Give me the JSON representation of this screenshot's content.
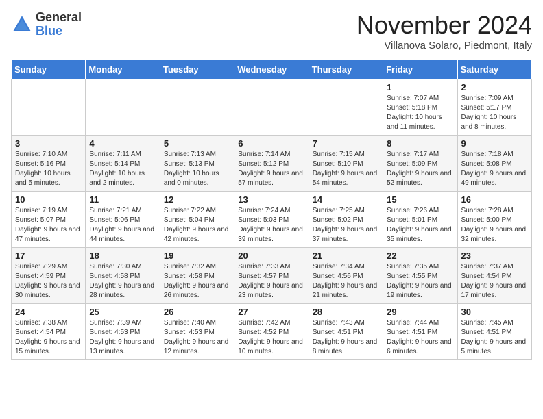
{
  "header": {
    "logo_general": "General",
    "logo_blue": "Blue",
    "month_title": "November 2024",
    "location": "Villanova Solaro, Piedmont, Italy"
  },
  "days_of_week": [
    "Sunday",
    "Monday",
    "Tuesday",
    "Wednesday",
    "Thursday",
    "Friday",
    "Saturday"
  ],
  "weeks": [
    [
      {
        "day": "",
        "info": ""
      },
      {
        "day": "",
        "info": ""
      },
      {
        "day": "",
        "info": ""
      },
      {
        "day": "",
        "info": ""
      },
      {
        "day": "",
        "info": ""
      },
      {
        "day": "1",
        "info": "Sunrise: 7:07 AM\nSunset: 5:18 PM\nDaylight: 10 hours and 11 minutes."
      },
      {
        "day": "2",
        "info": "Sunrise: 7:09 AM\nSunset: 5:17 PM\nDaylight: 10 hours and 8 minutes."
      }
    ],
    [
      {
        "day": "3",
        "info": "Sunrise: 7:10 AM\nSunset: 5:16 PM\nDaylight: 10 hours and 5 minutes."
      },
      {
        "day": "4",
        "info": "Sunrise: 7:11 AM\nSunset: 5:14 PM\nDaylight: 10 hours and 2 minutes."
      },
      {
        "day": "5",
        "info": "Sunrise: 7:13 AM\nSunset: 5:13 PM\nDaylight: 10 hours and 0 minutes."
      },
      {
        "day": "6",
        "info": "Sunrise: 7:14 AM\nSunset: 5:12 PM\nDaylight: 9 hours and 57 minutes."
      },
      {
        "day": "7",
        "info": "Sunrise: 7:15 AM\nSunset: 5:10 PM\nDaylight: 9 hours and 54 minutes."
      },
      {
        "day": "8",
        "info": "Sunrise: 7:17 AM\nSunset: 5:09 PM\nDaylight: 9 hours and 52 minutes."
      },
      {
        "day": "9",
        "info": "Sunrise: 7:18 AM\nSunset: 5:08 PM\nDaylight: 9 hours and 49 minutes."
      }
    ],
    [
      {
        "day": "10",
        "info": "Sunrise: 7:19 AM\nSunset: 5:07 PM\nDaylight: 9 hours and 47 minutes."
      },
      {
        "day": "11",
        "info": "Sunrise: 7:21 AM\nSunset: 5:06 PM\nDaylight: 9 hours and 44 minutes."
      },
      {
        "day": "12",
        "info": "Sunrise: 7:22 AM\nSunset: 5:04 PM\nDaylight: 9 hours and 42 minutes."
      },
      {
        "day": "13",
        "info": "Sunrise: 7:24 AM\nSunset: 5:03 PM\nDaylight: 9 hours and 39 minutes."
      },
      {
        "day": "14",
        "info": "Sunrise: 7:25 AM\nSunset: 5:02 PM\nDaylight: 9 hours and 37 minutes."
      },
      {
        "day": "15",
        "info": "Sunrise: 7:26 AM\nSunset: 5:01 PM\nDaylight: 9 hours and 35 minutes."
      },
      {
        "day": "16",
        "info": "Sunrise: 7:28 AM\nSunset: 5:00 PM\nDaylight: 9 hours and 32 minutes."
      }
    ],
    [
      {
        "day": "17",
        "info": "Sunrise: 7:29 AM\nSunset: 4:59 PM\nDaylight: 9 hours and 30 minutes."
      },
      {
        "day": "18",
        "info": "Sunrise: 7:30 AM\nSunset: 4:58 PM\nDaylight: 9 hours and 28 minutes."
      },
      {
        "day": "19",
        "info": "Sunrise: 7:32 AM\nSunset: 4:58 PM\nDaylight: 9 hours and 26 minutes."
      },
      {
        "day": "20",
        "info": "Sunrise: 7:33 AM\nSunset: 4:57 PM\nDaylight: 9 hours and 23 minutes."
      },
      {
        "day": "21",
        "info": "Sunrise: 7:34 AM\nSunset: 4:56 PM\nDaylight: 9 hours and 21 minutes."
      },
      {
        "day": "22",
        "info": "Sunrise: 7:35 AM\nSunset: 4:55 PM\nDaylight: 9 hours and 19 minutes."
      },
      {
        "day": "23",
        "info": "Sunrise: 7:37 AM\nSunset: 4:54 PM\nDaylight: 9 hours and 17 minutes."
      }
    ],
    [
      {
        "day": "24",
        "info": "Sunrise: 7:38 AM\nSunset: 4:54 PM\nDaylight: 9 hours and 15 minutes."
      },
      {
        "day": "25",
        "info": "Sunrise: 7:39 AM\nSunset: 4:53 PM\nDaylight: 9 hours and 13 minutes."
      },
      {
        "day": "26",
        "info": "Sunrise: 7:40 AM\nSunset: 4:53 PM\nDaylight: 9 hours and 12 minutes."
      },
      {
        "day": "27",
        "info": "Sunrise: 7:42 AM\nSunset: 4:52 PM\nDaylight: 9 hours and 10 minutes."
      },
      {
        "day": "28",
        "info": "Sunrise: 7:43 AM\nSunset: 4:51 PM\nDaylight: 9 hours and 8 minutes."
      },
      {
        "day": "29",
        "info": "Sunrise: 7:44 AM\nSunset: 4:51 PM\nDaylight: 9 hours and 6 minutes."
      },
      {
        "day": "30",
        "info": "Sunrise: 7:45 AM\nSunset: 4:51 PM\nDaylight: 9 hours and 5 minutes."
      }
    ]
  ]
}
